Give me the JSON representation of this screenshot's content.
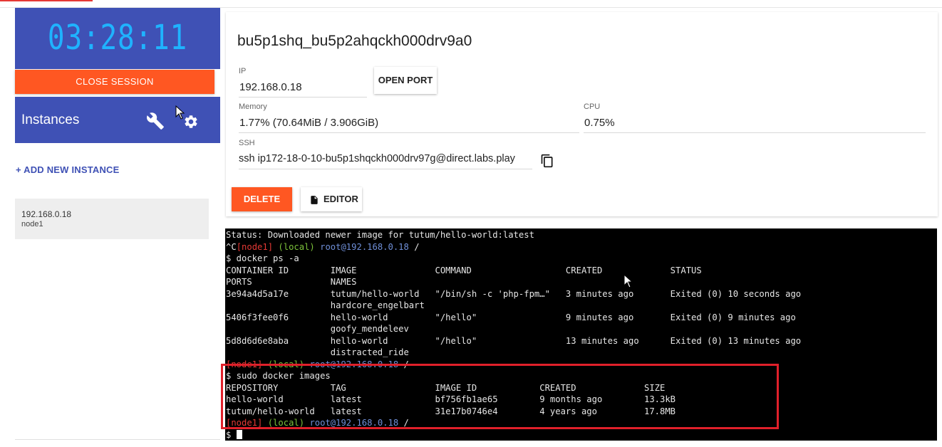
{
  "sidebar": {
    "timer": "03:28:11",
    "close_session_label": "CLOSE SESSION",
    "instances_title": "Instances",
    "add_instance_label": "+ ADD NEW INSTANCE",
    "instances": [
      {
        "ip": "192.168.0.18",
        "name": "node1"
      }
    ]
  },
  "instance": {
    "hostname": "bu5p1shq_bu5p2ahqckh000drv9a0",
    "ip_label": "IP",
    "ip_value": "192.168.0.18",
    "open_port_label": "OPEN PORT",
    "memory_label": "Memory",
    "memory_value": "1.77% (70.64MiB / 3.906GiB)",
    "cpu_label": "CPU",
    "cpu_value": "0.75%",
    "ssh_label": "SSH",
    "ssh_value": "ssh ip172-18-0-10-bu5p1shqckh000drv97g@direct.labs.play",
    "delete_label": "DELETE",
    "editor_label": "EDITOR"
  },
  "terminal": {
    "prompt_node": "[node1]",
    "prompt_local": "(local)",
    "prompt_user": "root@192.168.0.18",
    "lines": {
      "status": "Status: Downloaded newer image for tutum/hello-world:latest",
      "ctrl_c": "^C",
      "cmd_ps": "$ docker ps -a",
      "ps_header1": "CONTAINER ID        IMAGE               COMMAND                  CREATED             STATUS",
      "ps_header2": "PORTS               NAMES",
      "ps_row1a": "3e94a4d5a17e        tutum/hello-world   \"/bin/sh -c 'php-fpm…\"   3 minutes ago       Exited (0) 10 seconds ago",
      "ps_row1b": "                    hardcore_engelbart",
      "ps_row2a": "5406f3fee0f6        hello-world         \"/hello\"                 9 minutes ago       Exited (0) 9 minutes ago",
      "ps_row2b": "                    goofy_mendeleev",
      "ps_row3a": "5d8d6d6e8aba        hello-world         \"/hello\"                 13 minutes ago      Exited (0) 13 minutes ago",
      "ps_row3b": "                    distracted_ride",
      "cmd_images": "$ sudo docker images",
      "img_header": "REPOSITORY          TAG                 IMAGE ID            CREATED             SIZE",
      "img_row1": "hello-world         latest              bf756fb1ae65        9 months ago        13.3kB",
      "img_row2": "tutum/hello-world   latest              31e17b0746e4        4 years ago         17.8MB",
      "final_prompt": "$ "
    }
  },
  "colors": {
    "primary": "#3f51b5",
    "accent": "#ff5722",
    "timer": "#1fb3ff",
    "highlight": "#e0202a"
  },
  "icons": [
    "wrench-icon",
    "gear-icon",
    "copy-icon",
    "file-icon",
    "mouse-pointer-icon"
  ]
}
